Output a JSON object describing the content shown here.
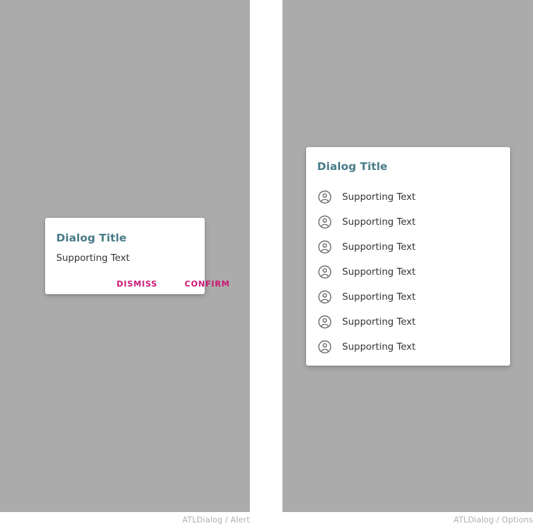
{
  "canvas": {
    "background": "#ffffff",
    "panel_background": "#ababab"
  },
  "colors": {
    "title": "#487b87",
    "action": "#cc1a77",
    "body_text": "#333333",
    "icon": "#6e6e6e",
    "footer_text": "#b0b0b0"
  },
  "panels": [
    {
      "id": "alert",
      "footer_label": "ATLDialog / Alert",
      "dialog": {
        "title": "Dialog Title",
        "supporting_text": "Supporting Text",
        "actions": [
          {
            "label": "DISMISS"
          },
          {
            "label": "CONFIRM"
          }
        ]
      }
    },
    {
      "id": "options",
      "footer_label": "ATLDialog / Options",
      "dialog": {
        "title": "Dialog Title",
        "options": [
          {
            "icon": "account-circle-icon",
            "label": "Supporting Text"
          },
          {
            "icon": "account-circle-icon",
            "label": "Supporting Text"
          },
          {
            "icon": "account-circle-icon",
            "label": "Supporting Text"
          },
          {
            "icon": "account-circle-icon",
            "label": "Supporting Text"
          },
          {
            "icon": "account-circle-icon",
            "label": "Supporting Text"
          },
          {
            "icon": "account-circle-icon",
            "label": "Supporting Text"
          },
          {
            "icon": "account-circle-icon",
            "label": "Supporting Text"
          }
        ]
      }
    }
  ]
}
